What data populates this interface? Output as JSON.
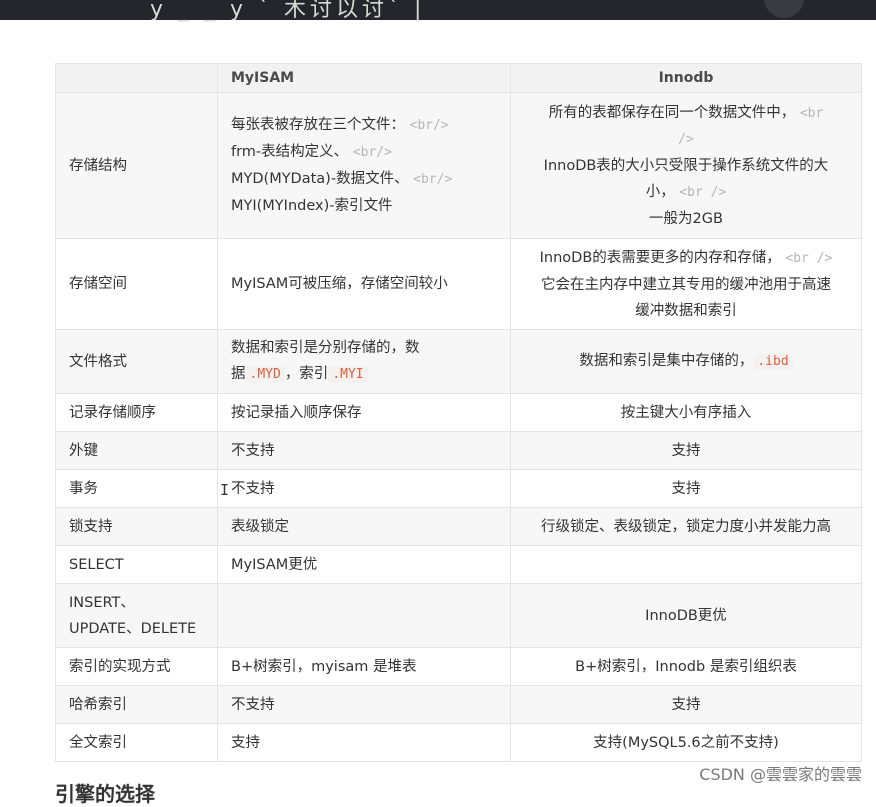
{
  "top_bar": {
    "title_fragment": "y _ _ y  ` 木讨以讨` |"
  },
  "table": {
    "headers": [
      "",
      "MyISAM",
      "Innodb"
    ],
    "rows": [
      {
        "name": "存储结构",
        "myisam": [
          "每张表被存放在三个文件：",
          "<br/>",
          "frm-表结构定义、",
          "<br/>",
          "MYD(MYData)-数据文件、",
          "<br/>",
          "MYI(MYIndex)-索引文件"
        ],
        "innodb": [
          "所有的表都保存在同一个数据文件中，",
          "<br",
          "/>",
          "InnoDB表的大小只受限于操作系统文件的大",
          "小，",
          "<br />",
          "一般为2GB"
        ]
      },
      {
        "name": "存储空间",
        "myisam": [
          "MyISAM可被压缩，存储空间较小"
        ],
        "innodb": [
          "InnoDB的表需要更多的内存和存储，",
          "<br />",
          "它会在主内存中建立其专用的缓冲池用于高速",
          "缓冲数据和索引"
        ]
      },
      {
        "name": "文件格式",
        "myisam": [
          "数据和索引是分别存储的，数",
          "据",
          ".MYD",
          "，索引",
          ".MYI"
        ],
        "innodb": [
          "数据和索引是集中存储的，",
          ".ibd"
        ]
      },
      {
        "name": "记录存储顺序",
        "myisam": [
          "按记录插入顺序保存"
        ],
        "innodb": [
          "按主键大小有序插入"
        ]
      },
      {
        "name": "外键",
        "myisam": [
          "不支持"
        ],
        "innodb": [
          "支持"
        ]
      },
      {
        "name": "事务",
        "myisam": [
          "不支持"
        ],
        "innodb": [
          "支持"
        ]
      },
      {
        "name": "锁支持",
        "myisam": [
          "表级锁定"
        ],
        "innodb": [
          "行级锁定、表级锁定，锁定力度小并发能力高"
        ]
      },
      {
        "name": "SELECT",
        "myisam": [
          "MyISAM更优"
        ],
        "innodb": [
          ""
        ]
      },
      {
        "name": [
          "INSERT、",
          "UPDATE、DELETE"
        ],
        "myisam": [
          ""
        ],
        "innodb": [
          "InnoDB更优"
        ]
      },
      {
        "name": "索引的实现方式",
        "myisam": [
          "B+树索引，myisam 是堆表"
        ],
        "innodb": [
          "B+树索引，Innodb 是索引组织表"
        ]
      },
      {
        "name": "哈希索引",
        "myisam": [
          "不支持"
        ],
        "innodb": [
          "支持"
        ]
      },
      {
        "name": "全文索引",
        "myisam": [
          "支持"
        ],
        "innodb": [
          "支持(MySQL5.6之前不支持)"
        ]
      }
    ]
  },
  "next_heading": "引擎的选择",
  "watermark": "CSDN @雲雲家的雲雲"
}
